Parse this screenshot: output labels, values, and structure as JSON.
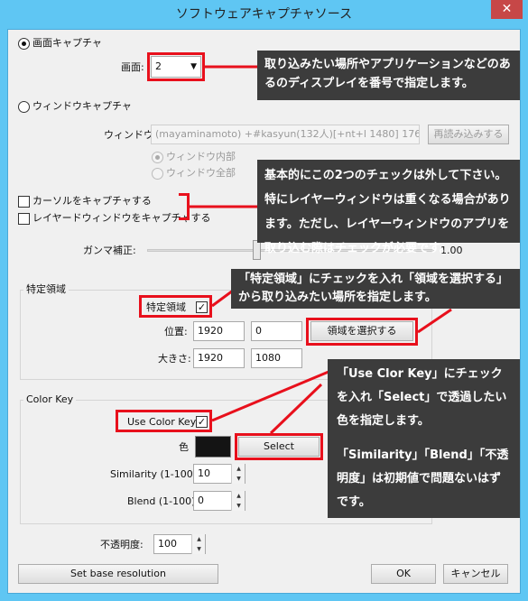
{
  "window": {
    "title": "ソフトウェアキャプチャソース",
    "close_glyph": "✕"
  },
  "screen_capture": {
    "radio_label": "画面キャプチャ",
    "screen_label": "画面:",
    "screen_value": "2"
  },
  "window_capture": {
    "radio_label": "ウィンドウキャプチャ",
    "window_label": "ウィンドウ:",
    "window_value": "(mayaminamoto) +#kasyun(132人)[+nt+l 1480] 1764 8€",
    "reload_button": "再読み込みする",
    "inner_label": "ウィンドウ内部",
    "full_label": "ウィンドウ全部"
  },
  "options": {
    "capture_cursor": "カーソルをキャプチャする",
    "capture_layered": "レイヤードウィンドウをキャプチャする",
    "gamma_label": "ガンマ補正:",
    "gamma_value": "1.00",
    "gamma_fraction": 0.38
  },
  "region": {
    "group_label": "特定領域",
    "checkbox_label": "特定領域",
    "checked_glyph": "✓",
    "position_label": "位置:",
    "pos_x": "1920",
    "pos_y": "0",
    "size_label": "大きさ:",
    "size_w": "1920",
    "size_h": "1080",
    "select_button": "領域を選択する"
  },
  "color_key": {
    "group_label": "Color Key",
    "use_label": "Use Color Key:",
    "color_label": "色",
    "color_hex": "#141414",
    "select_button": "Select",
    "similarity_label": "Similarity (1-100):",
    "similarity_value": "10",
    "blend_label": "Blend (1-100):",
    "blend_value": "0"
  },
  "opacity": {
    "label": "不透明度:",
    "value": "100"
  },
  "footer": {
    "base_res_button": "Set base resolution",
    "ok_button": "OK",
    "cancel_button": "キャンセル"
  },
  "annotations": {
    "note1": "取り込みたい場所やアプリケーションなどのあるのディスプレイを番号で指定します。",
    "note2": "基本的にこの2つのチェックは外して下さい。特にレイヤーウィンドウは重くなる場合があります。ただし、レイヤーウィンドウのアプリを取り込む際はチェックが必要です。",
    "note3": "「特定領域」にチェックを入れ「領域を選択する」から取り込みたい場所を指定します。",
    "note4a": "「Use Clor Key」にチェックを入れ「Select」で透過したい色を指定します。",
    "note4b": "「Similarity」「Blend」「不透明度」は初期値で問題ないはずです。"
  },
  "colors": {
    "frame": "#5fc6f3",
    "highlight": "#e8101c",
    "note_bg": "#3c3c3c",
    "close": "#c74747"
  }
}
